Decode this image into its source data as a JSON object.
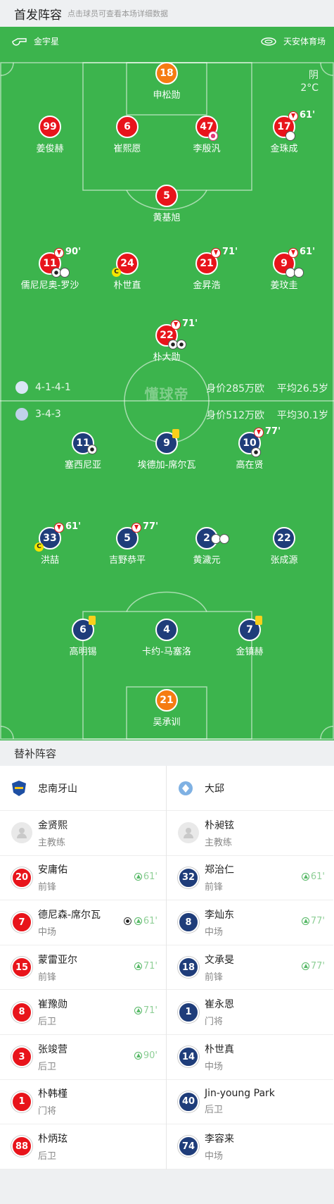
{
  "header": {
    "title": "首发阵容",
    "subtitle": "点击球员可查看本场详细数据"
  },
  "match": {
    "referee": "金宇星",
    "stadium": "天安体育场",
    "weather": "阴",
    "temperature": "2°C",
    "watermark": "懂球帝"
  },
  "home": {
    "formation": "4-1-4-1",
    "value": "身价285万欧",
    "age": "平均26.5岁",
    "players": [
      {
        "num": "18",
        "name": "申松勋"
      },
      {
        "num": "99",
        "name": "姜俊赫"
      },
      {
        "num": "6",
        "name": "崔熙愿"
      },
      {
        "num": "47",
        "name": "李殷汎"
      },
      {
        "num": "17",
        "name": "金珠成",
        "sub": "61'"
      },
      {
        "num": "5",
        "name": "黄基旭"
      },
      {
        "num": "11",
        "name": "儒尼尼奥-罗沙",
        "sub": "90'"
      },
      {
        "num": "24",
        "name": "朴世直",
        "captain": "C"
      },
      {
        "num": "21",
        "name": "金昇浩",
        "sub": "71'"
      },
      {
        "num": "9",
        "name": "姜玟圭",
        "sub": "61'"
      },
      {
        "num": "22",
        "name": "朴大勋",
        "sub": "71'"
      }
    ]
  },
  "away": {
    "formation": "3-4-3",
    "value": "身价512万欧",
    "age": "平均30.1岁",
    "players": [
      {
        "num": "11",
        "name": "塞西尼亚"
      },
      {
        "num": "9",
        "name": "埃德加-席尔瓦"
      },
      {
        "num": "10",
        "name": "高在贤",
        "sub": "77'"
      },
      {
        "num": "33",
        "name": "洪喆",
        "sub": "61'",
        "captain": "C"
      },
      {
        "num": "5",
        "name": "吉野恭平",
        "sub": "77'"
      },
      {
        "num": "2",
        "name": "黄濊元"
      },
      {
        "num": "22",
        "name": "张成源"
      },
      {
        "num": "6",
        "name": "高明锡"
      },
      {
        "num": "4",
        "name": "卡约-马塞洛"
      },
      {
        "num": "7",
        "name": "金镇赫"
      },
      {
        "num": "21",
        "name": "吴承训"
      }
    ]
  },
  "subs": {
    "title": "替补阵容",
    "home_team": "忠南牙山",
    "away_team": "大邱",
    "home": [
      {
        "name": "金贤熙",
        "pos": "主教练"
      },
      {
        "num": "20",
        "name": "安庸佑",
        "pos": "前锋",
        "in": "61'"
      },
      {
        "num": "7",
        "name": "德尼森-席尔瓦",
        "pos": "中场",
        "in": "61'"
      },
      {
        "num": "15",
        "name": "蒙雷亚尔",
        "pos": "前锋",
        "in": "71'"
      },
      {
        "num": "8",
        "name": "崔豫勋",
        "pos": "后卫",
        "in": "71'"
      },
      {
        "num": "3",
        "name": "张竣营",
        "pos": "后卫",
        "in": "90'"
      },
      {
        "num": "1",
        "name": "朴韩槿",
        "pos": "门将"
      },
      {
        "num": "88",
        "name": "朴炳玹",
        "pos": "后卫"
      }
    ],
    "away": [
      {
        "name": "朴昶铉",
        "pos": "主教练"
      },
      {
        "num": "32",
        "name": "郑治仁",
        "pos": "前锋",
        "in": "61'"
      },
      {
        "num": "8",
        "name": "李灿东",
        "pos": "中场",
        "in": "77'"
      },
      {
        "num": "18",
        "name": "文承旻",
        "pos": "前锋",
        "in": "77'"
      },
      {
        "num": "1",
        "name": "崔永恩",
        "pos": "门将"
      },
      {
        "num": "14",
        "name": "朴世真",
        "pos": "中场"
      },
      {
        "num": "40",
        "name": "Jin-young Park",
        "pos": "后卫"
      },
      {
        "num": "74",
        "name": "李容来",
        "pos": "中场"
      }
    ]
  }
}
